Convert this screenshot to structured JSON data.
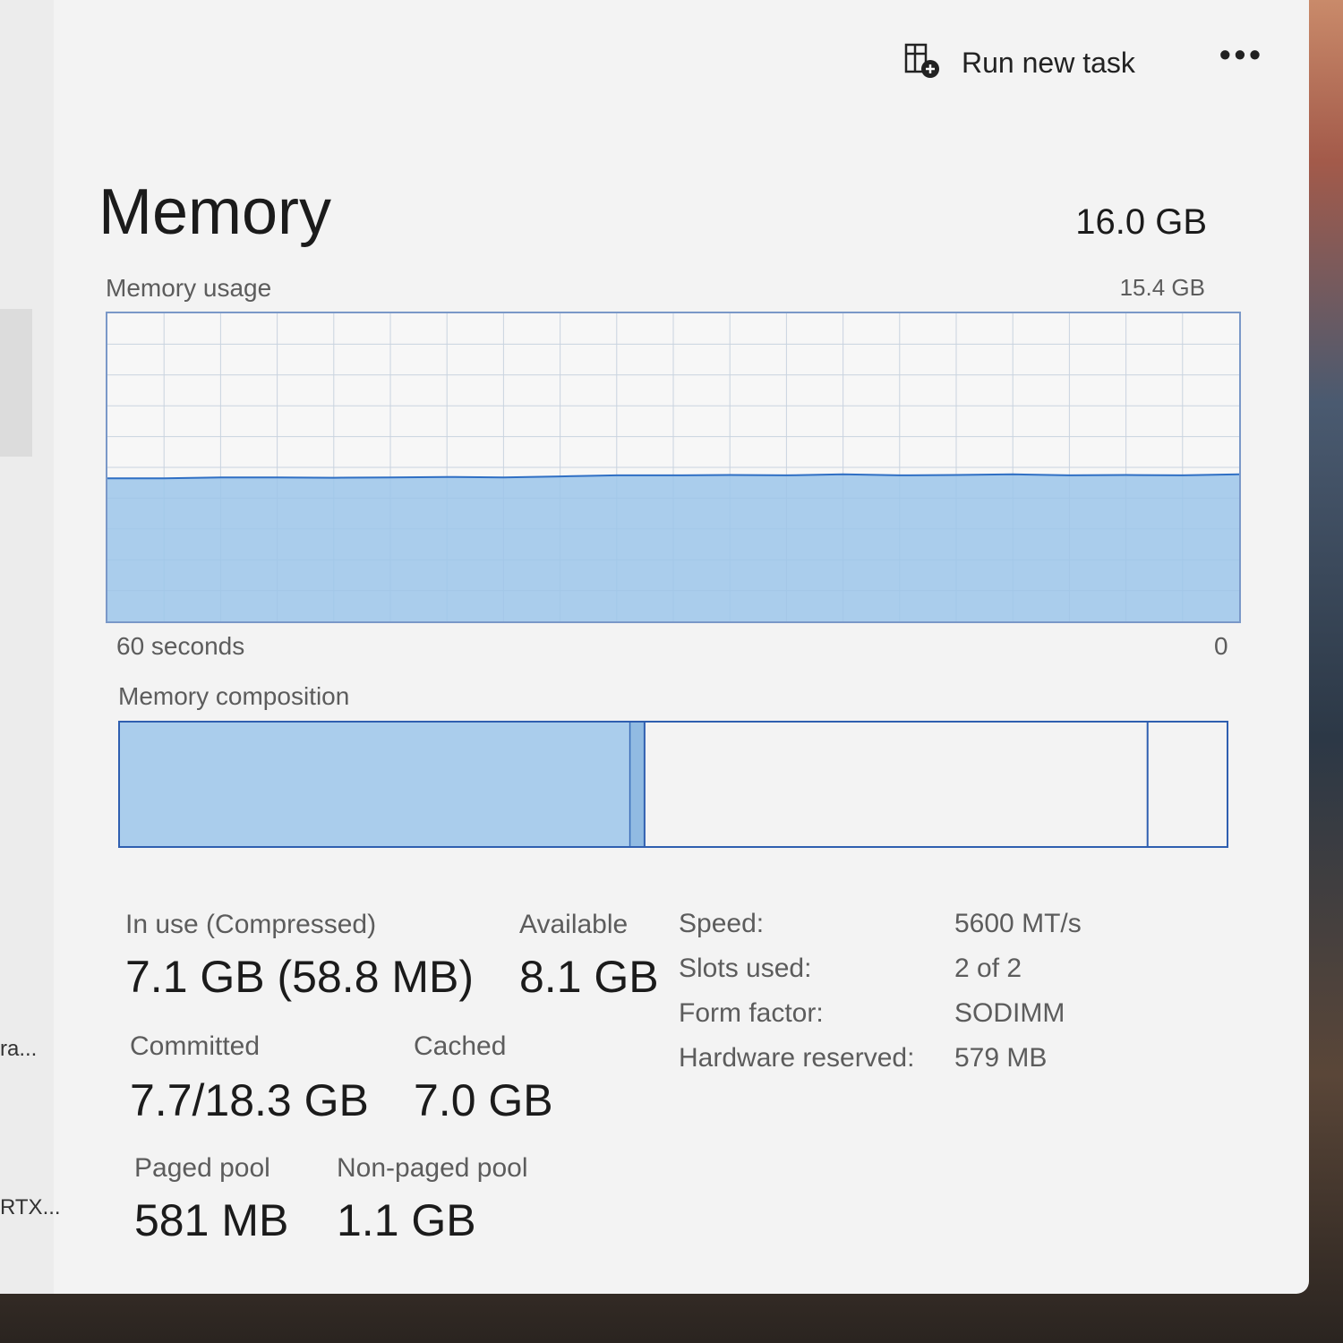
{
  "toolbar": {
    "run_new_task_label": "Run new task",
    "more_label": "•••",
    "run_new_task_icon": "run-task-icon"
  },
  "sidebar": {
    "truncated_items": [
      "ra...",
      "RTX..."
    ]
  },
  "memory": {
    "title": "Memory",
    "total": "16.0 GB",
    "usage_label": "Memory usage",
    "usage_max": "15.4 GB",
    "axis_left": "60 seconds",
    "axis_right": "0",
    "composition_label": "Memory composition"
  },
  "stats": {
    "in_use_label": "In use (Compressed)",
    "in_use_value": "7.1 GB (58.8 MB)",
    "available_label": "Available",
    "available_value": "8.1 GB",
    "committed_label": "Committed",
    "committed_value": "7.7/18.3 GB",
    "cached_label": "Cached",
    "cached_value": "7.0 GB",
    "paged_label": "Paged pool",
    "paged_value": "581 MB",
    "nonpaged_label": "Non-paged pool",
    "nonpaged_value": "1.1 GB"
  },
  "specs": [
    {
      "label": "Speed:",
      "value": "5600 MT/s"
    },
    {
      "label": "Slots used:",
      "value": "2 of 2"
    },
    {
      "label": "Form factor:",
      "value": "SODIMM"
    },
    {
      "label": "Hardware reserved:",
      "value": "579 MB"
    }
  ],
  "chart_data": {
    "type": "area",
    "title": "Memory usage",
    "ylim": [
      0,
      15.4
    ],
    "xlabel_left": "60 seconds",
    "xlabel_right": "0",
    "values": [
      7.15,
      7.15,
      7.2,
      7.2,
      7.18,
      7.2,
      7.22,
      7.2,
      7.25,
      7.3,
      7.3,
      7.32,
      7.3,
      7.35,
      7.3,
      7.32,
      7.35,
      7.3,
      7.32,
      7.3,
      7.35
    ],
    "composition": {
      "in_use": 7.1,
      "modified": 0.2,
      "standby": 7.0,
      "free": 1.1
    },
    "colors": {
      "line": "#2f6fc4",
      "fill": "#9cc6ea",
      "grid": "#c9d3df",
      "border": "#2f5fb0"
    }
  }
}
